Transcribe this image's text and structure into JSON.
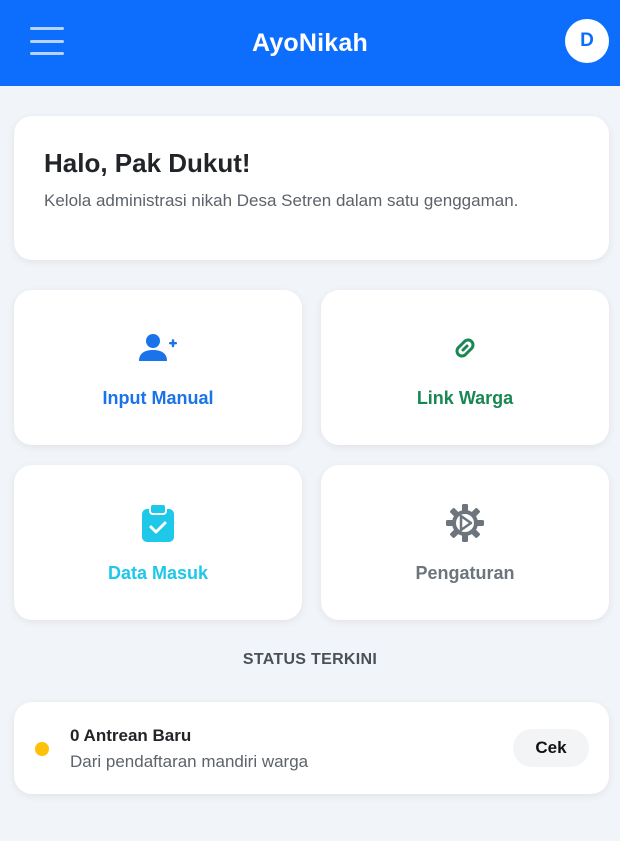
{
  "header": {
    "title": "AyoNikah",
    "avatar_initial": "D",
    "menu_icon": "hamburger-menu-icon"
  },
  "greeting": {
    "title": "Halo, Pak Dukut!",
    "subtitle": "Kelola administrasi nikah Desa Setren dalam satu genggaman."
  },
  "tiles": [
    {
      "label": "Input Manual",
      "icon": "user-plus-icon",
      "color": "#1a73e8"
    },
    {
      "label": "Link Warga",
      "icon": "link-icon",
      "color": "#198754"
    },
    {
      "label": "Data Masuk",
      "icon": "clipboard-check-icon",
      "color": "#1ec8e8"
    },
    {
      "label": "Pengaturan",
      "icon": "gear-icon",
      "color": "#6c757d"
    }
  ],
  "status": {
    "section_title": "STATUS TERKINI",
    "title": "0 Antrean Baru",
    "subtitle": "Dari pendaftaran mandiri warga",
    "button_label": "Cek",
    "dot_color": "#ffc107"
  },
  "colors": {
    "primary": "#0d6efd",
    "background": "#f1f4f8"
  }
}
